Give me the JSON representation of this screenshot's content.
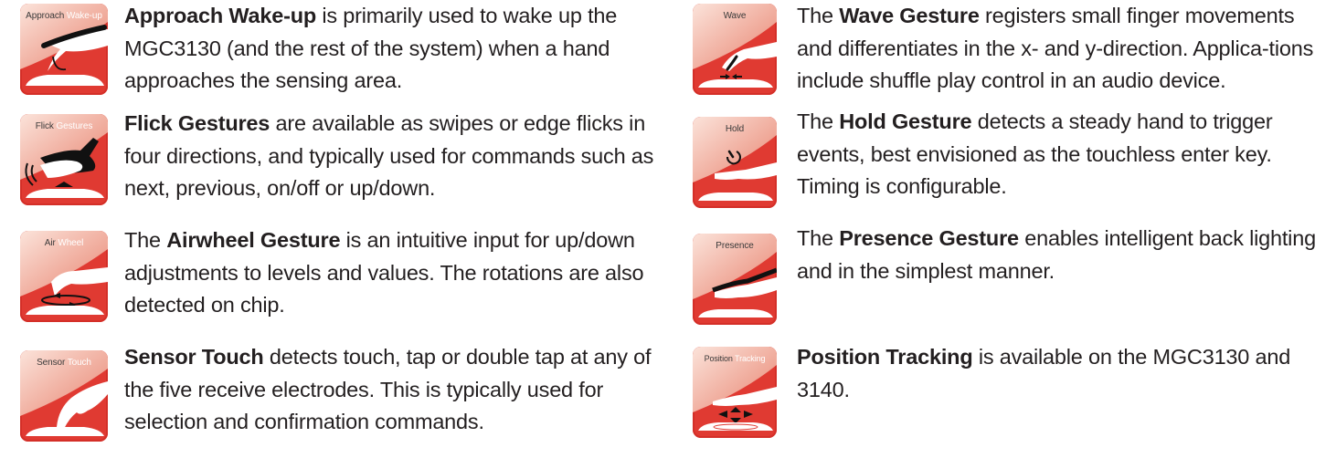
{
  "colors": {
    "icon_red": "#e03a32",
    "text": "#231f20",
    "icon_label_dark": "#3a3a3a",
    "icon_label_light": "#ffffff"
  },
  "gestures": [
    {
      "id": "approach-wakeup",
      "icon": "approach-wakeup-icon",
      "icon_label": [
        "Approach",
        "Wake-up"
      ],
      "lead": "",
      "title": "Approach Wake-up",
      "text": " is primarily used to wake up the MGC3130 (and the rest of the system) when a hand approaches the sensing area."
    },
    {
      "id": "flick",
      "icon": "flick-gestures-icon",
      "icon_label": [
        "Flick",
        "Gestures"
      ],
      "lead": "",
      "title": "Flick Gestures",
      "text": " are available as swipes or edge flicks in four directions, and typically used for commands such as next, previous, on/off or up/down."
    },
    {
      "id": "airwheel",
      "icon": "air-wheel-icon",
      "icon_label": [
        "Air",
        "Wheel"
      ],
      "lead": "The ",
      "title": "Airwheel Gesture",
      "text": " is an intuitive input for up/down adjustments to levels and values. The rotations are also detected on chip."
    },
    {
      "id": "sensor-touch",
      "icon": "sensor-touch-icon",
      "icon_label": [
        "Sensor",
        "Touch"
      ],
      "lead": "",
      "title": "Sensor Touch",
      "text": " detects touch, tap or double tap at any of the five receive electrodes. This is typically used for selection and confirmation commands."
    },
    {
      "id": "wave",
      "icon": "wave-icon",
      "icon_label": [
        "Wave",
        ""
      ],
      "lead": "The ",
      "title": "Wave Gesture",
      "text": " registers small finger movements and differentiates in the x- and y-direction. Applica-tions include shuffle play control in an audio device."
    },
    {
      "id": "hold",
      "icon": "hold-icon",
      "icon_label": [
        "Hold",
        ""
      ],
      "lead": "The ",
      "title": "Hold Gesture",
      "text": " detects a steady hand to trigger events, best envisioned as the touchless enter key. Timing is configurable."
    },
    {
      "id": "presence",
      "icon": "presence-icon",
      "icon_label": [
        "Presence",
        ""
      ],
      "lead": "The ",
      "title": "Presence Gesture",
      "text": " enables intelligent back lighting and in the simplest manner."
    },
    {
      "id": "position-tracking",
      "icon": "position-tracking-icon",
      "icon_label": [
        "Position",
        "Tracking"
      ],
      "lead": "",
      "title": "Position Tracking",
      "text": " is available on the MGC3130 and 3140."
    }
  ]
}
